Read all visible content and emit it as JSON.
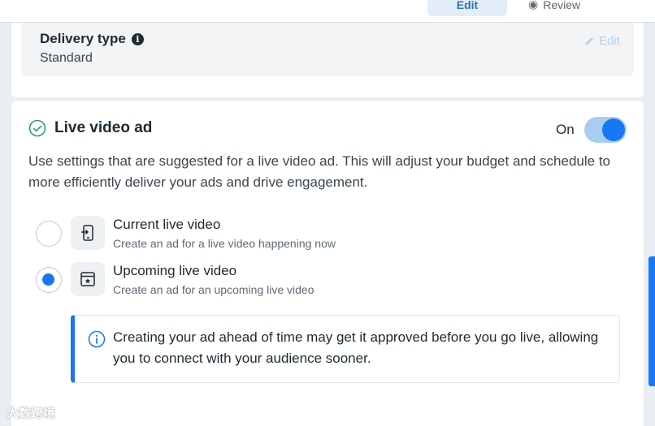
{
  "tabs": {
    "edit_label": "Edit",
    "review_label": "Review"
  },
  "delivery": {
    "title": "Delivery type",
    "value": "Standard",
    "edit_label": "Edit"
  },
  "live_video": {
    "title": "Live video ad",
    "toggle_label": "On",
    "toggle_on": true,
    "description": "Use settings that are suggested for a live video ad. This will adjust your budget and schedule to more efficiently deliver your ads and drive engagement.",
    "options": [
      {
        "title": "Current live video",
        "subtitle": "Create an ad for a live video happening now",
        "selected": false,
        "icon": "phone-enter-icon"
      },
      {
        "title": "Upcoming live video",
        "subtitle": "Create an ad for an upcoming live video",
        "selected": true,
        "icon": "calendar-star-icon"
      }
    ],
    "notice": "Creating your ad ahead of time may get it approved before you go live, allowing you to connect with your audience sooner."
  },
  "colors": {
    "accent": "#1877f2",
    "text": "#1c2b33",
    "background": "#e8eef4"
  },
  "watermark": "大数跨境"
}
